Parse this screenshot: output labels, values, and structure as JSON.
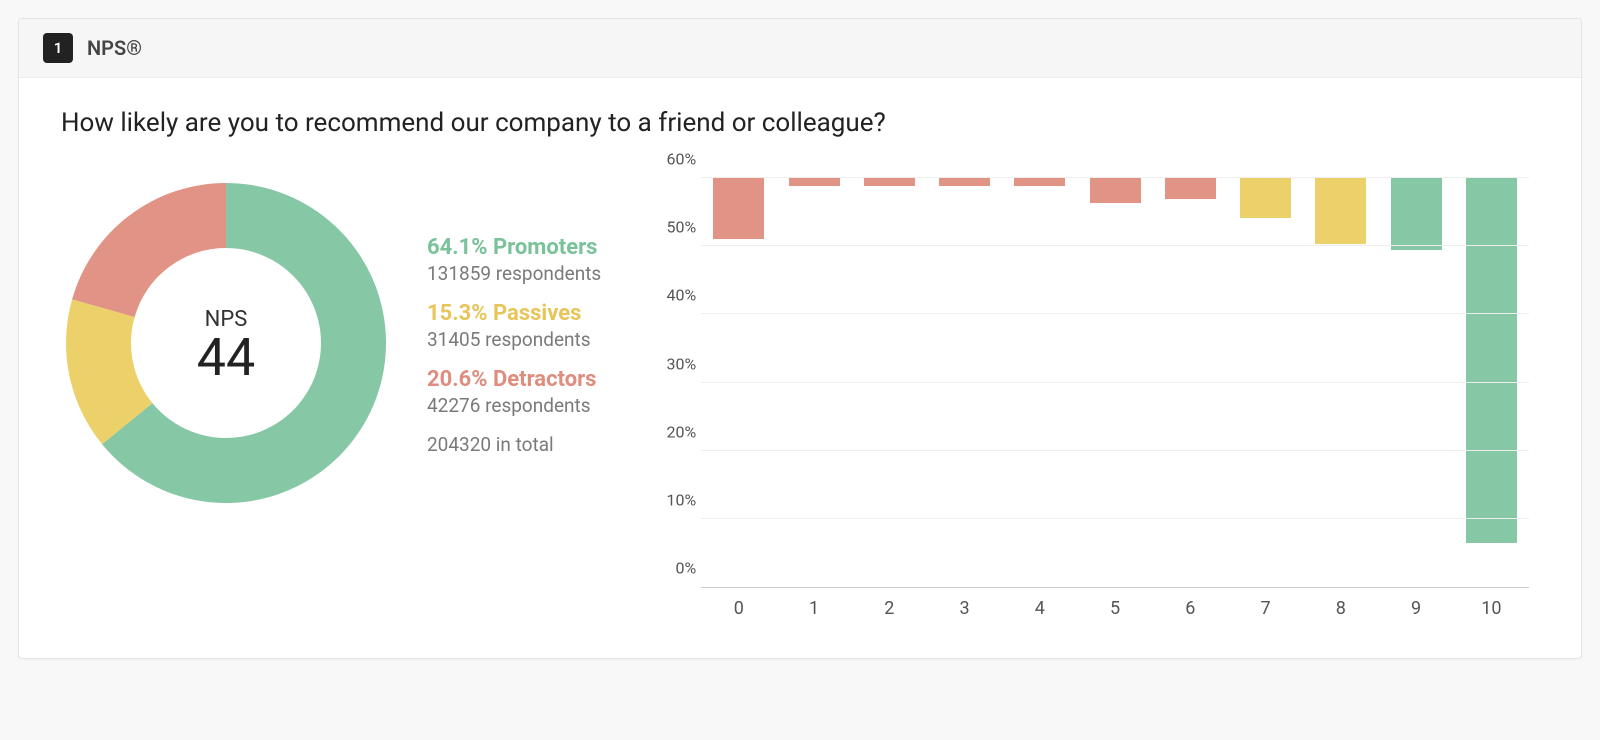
{
  "header": {
    "number": "1",
    "title": "NPS®"
  },
  "question": "How likely are you to recommend our company to a friend or colleague?",
  "donut": {
    "nps_label": "NPS",
    "nps_score": "44",
    "promoters": {
      "pct": "64.1% Promoters",
      "resp": "131859 respondents"
    },
    "passives": {
      "pct": "15.3% Passives",
      "resp": "31405 respondents"
    },
    "detractors": {
      "pct": "20.6% Detractors",
      "resp": "42276 respondents"
    },
    "total": "204320 in total"
  },
  "colors": {
    "promoter": "#86c7a6",
    "passive": "#ecd06a",
    "detractor": "#e19486"
  },
  "chart_data": [
    {
      "type": "pie",
      "title": "NPS",
      "series": [
        {
          "name": "Promoters",
          "value": 64.1,
          "respondents": 131859,
          "color": "#86c7a6"
        },
        {
          "name": "Passives",
          "value": 15.3,
          "respondents": 31405,
          "color": "#ecd06a"
        },
        {
          "name": "Detractors",
          "value": 20.6,
          "respondents": 42276,
          "color": "#e19486"
        }
      ],
      "total_respondents": 204320,
      "nps": 44
    },
    {
      "type": "bar",
      "title": "",
      "xlabel": "",
      "ylabel": "",
      "categories": [
        "0",
        "1",
        "2",
        "3",
        "4",
        "5",
        "6",
        "7",
        "8",
        "9",
        "10"
      ],
      "values": [
        9.0,
        1.2,
        1.2,
        1.2,
        1.2,
        3.6,
        3.1,
        5.8,
        9.7,
        10.5,
        53.5
      ],
      "segment": [
        "detractor",
        "detractor",
        "detractor",
        "detractor",
        "detractor",
        "detractor",
        "detractor",
        "passive",
        "passive",
        "promoter",
        "promoter"
      ],
      "ylim": [
        0,
        60
      ],
      "yticks": [
        0,
        10,
        20,
        30,
        40,
        50,
        60
      ],
      "ytick_labels": [
        "0%",
        "10%",
        "20%",
        "30%",
        "40%",
        "50%",
        "60%"
      ]
    }
  ]
}
